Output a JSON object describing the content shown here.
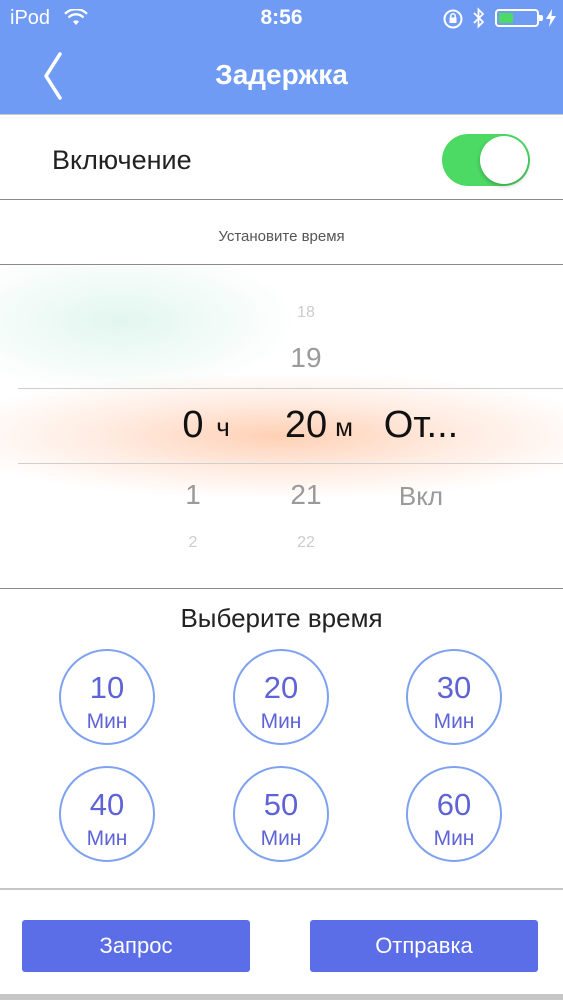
{
  "status_bar": {
    "carrier": "iPod",
    "time": "8:56"
  },
  "nav": {
    "title": "Задержка"
  },
  "toggle": {
    "label": "Включение",
    "state": true
  },
  "set_time": {
    "label": "Установите время"
  },
  "picker": {
    "hours": {
      "above_far": "",
      "above": "",
      "selected": "0",
      "unit": "ч",
      "below": "1",
      "below_far": "2"
    },
    "minutes": {
      "above_far": "18",
      "above": "19",
      "selected": "20",
      "unit": "м",
      "below": "21",
      "below_far": "22"
    },
    "mode": {
      "selected": "От...",
      "below": "Вкл"
    }
  },
  "choose_time": {
    "title": "Выберите время",
    "options": [
      {
        "value": "10",
        "unit": "Мин"
      },
      {
        "value": "20",
        "unit": "Мин"
      },
      {
        "value": "30",
        "unit": "Мин"
      },
      {
        "value": "40",
        "unit": "Мин"
      },
      {
        "value": "50",
        "unit": "Мин"
      },
      {
        "value": "60",
        "unit": "Мин"
      }
    ]
  },
  "actions": {
    "query_label": "Запрос",
    "send_label": "Отправка"
  },
  "colors": {
    "header": "#6f9bf5",
    "toggle_on": "#4cd964",
    "circle_border": "#7ea2f0",
    "circle_text": "#5e63d6",
    "button": "#5b6ee8"
  },
  "icons": [
    "wifi-icon",
    "orientation-lock-icon",
    "bluetooth-icon",
    "battery-icon",
    "charging-icon",
    "back-chevron-icon"
  ]
}
